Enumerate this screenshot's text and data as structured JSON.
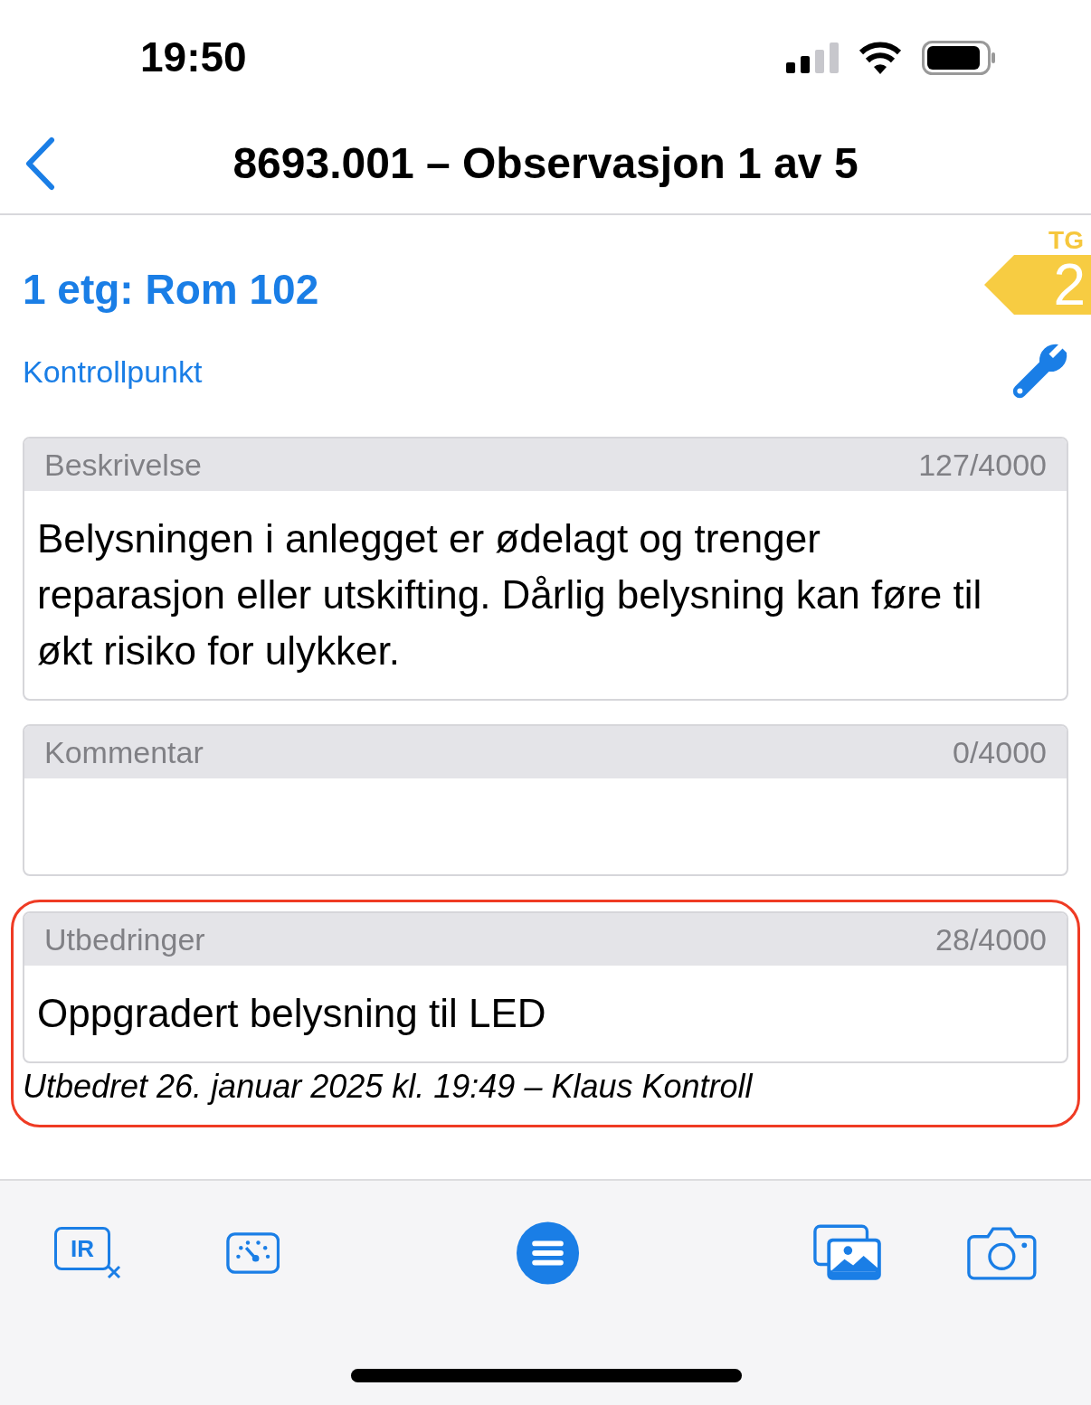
{
  "status_bar": {
    "time": "19:50"
  },
  "nav": {
    "title": "8693.001 – Observasjon 1 av 5"
  },
  "location": "1 etg: Rom 102",
  "grade": {
    "label": "TG",
    "value": "2"
  },
  "control_point": "Kontrollpunkt",
  "fields": [
    {
      "label": "Beskrivelse",
      "count": "127/4000",
      "value": "Belysningen i anlegget er ødelagt og trenger reparasjon eller utskifting. Dårlig belysning kan føre til økt risiko for ulykker.",
      "highlighted": false
    },
    {
      "label": "Kommentar",
      "count": "0/4000",
      "highlighted": false
    },
    {
      "label": "Utbedringer",
      "count": "28/4000",
      "value": "Oppgradert belysning til LED",
      "highlighted": true,
      "note": "Utbedret 26. januar 2025 kl. 19:49 – Klaus Kontroll"
    }
  ],
  "toolbar": {
    "ir_label": "IR"
  }
}
